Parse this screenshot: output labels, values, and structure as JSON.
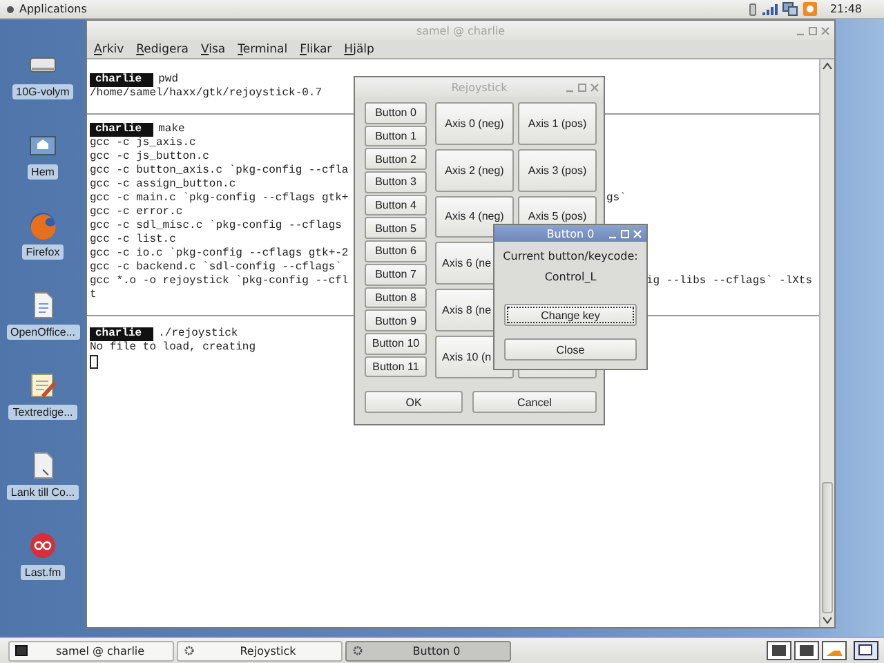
{
  "top_panel": {
    "menu": "Applications",
    "clock": "21:48"
  },
  "desktop_icons": [
    {
      "label": "10G-volym",
      "kind": "drive"
    },
    {
      "label": "Hem",
      "kind": "home"
    },
    {
      "label": "Firefox",
      "kind": "browser"
    },
    {
      "label": "OpenOffice...",
      "kind": "document"
    },
    {
      "label": "Textredige...",
      "kind": "editor"
    },
    {
      "label": "Lank till Co...",
      "kind": "file"
    },
    {
      "label": "Last.fm",
      "kind": "music"
    }
  ],
  "terminal": {
    "title": "samel @ charlie",
    "active": false,
    "menu": [
      "Arkiv",
      "Redigera",
      "Visa",
      "Terminal",
      "Flikar",
      "Hjälp"
    ],
    "blocks": [
      {
        "prompt": "charlie",
        "command": "pwd",
        "lines": [
          {
            "text": "/home/samel/haxx/gtk/rejoystick-0.7"
          }
        ]
      },
      {
        "prompt": "charlie",
        "command": "make",
        "lines": [
          {
            "text": "gcc -c js_axis.c"
          },
          {
            "text": "gcc -c js_button.c"
          },
          {
            "text": "gcc -c button_axis.c `pkg-config --cfla"
          },
          {
            "text": "gcc -c assign_button.c"
          },
          {
            "text": "gcc -c main.c `pkg-config --cflags gtk+",
            "tail": {
              "text": "gs`",
              "kind": "near"
            }
          },
          {
            "text": "gcc -c error.c"
          },
          {
            "text": "gcc -c sdl_misc.c `pkg-config --cflags"
          },
          {
            "text": "gcc -c list.c"
          },
          {
            "text": "gcc -c io.c `pkg-config --cflags gtk+-2"
          },
          {
            "text": "gcc -c backend.c `sdl-config --cflags`"
          },
          {
            "text": "gcc *.o -o rejoystick `pkg-config --cfl",
            "tail": {
              "text": "ig --libs --cflags` -lXts",
              "kind": "far"
            }
          },
          {
            "text": "t"
          }
        ]
      },
      {
        "prompt": "charlie",
        "command": "./rejoystick",
        "lines": [
          {
            "text": "No file to load, creating"
          }
        ]
      }
    ]
  },
  "rejoystick": {
    "title": "Rejoystick",
    "active": false,
    "buttons": [
      "Button 0",
      "Button 1",
      "Button 2",
      "Button 3",
      "Button 4",
      "Button 5",
      "Button 6",
      "Button 7",
      "Button 8",
      "Button 9",
      "Button 10",
      "Button 11"
    ],
    "axes": [
      "Axis 0 (neg)",
      "Axis 1 (pos)",
      "Axis 2 (neg)",
      "Axis 3 (pos)",
      "Axis 4 (neg)",
      "Axis 5 (pos)",
      "Axis 6 (ne",
      "Axis 8 (ne",
      "Axis 10 (n"
    ],
    "ok": "OK",
    "cancel": "Cancel"
  },
  "dialog": {
    "title": "Button 0",
    "active": true,
    "label": "Current button/keycode:",
    "value": "Control_L",
    "buttons": [
      {
        "label": "Change key",
        "focused": true
      },
      {
        "label": "Close",
        "focused": false
      }
    ]
  },
  "taskbar": {
    "tasks": [
      {
        "label": "samel @ charlie",
        "kind": "terminal",
        "selected": false
      },
      {
        "label": "Rejoystick",
        "kind": "app",
        "selected": false
      },
      {
        "label": "Button 0",
        "kind": "app",
        "selected": true
      }
    ]
  }
}
